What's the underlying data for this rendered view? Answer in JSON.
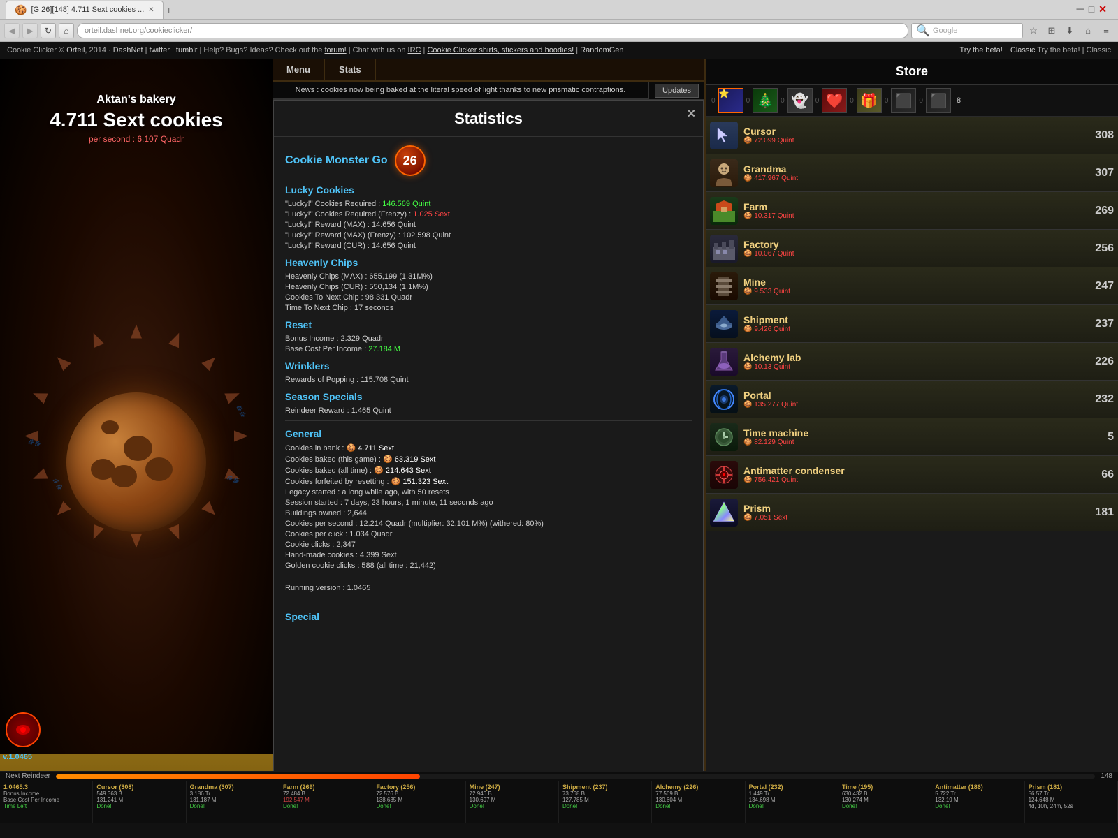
{
  "browser": {
    "tab_title": "[G 26][148] 4.711 Sext cookies ...",
    "address": "orteil.dashnet.org/cookieclicker/",
    "search_placeholder": "Google"
  },
  "site_header": {
    "copyright": "Cookie Clicker © Orteil, 2014 · DashNet | twitter | tumblr | Help? Bugs? Ideas? Check out the forum! | Chat with us on IRC | Cookie Clicker shirts, stickers and hoodies! | RandomGen",
    "twitter_link": "twitter",
    "try_beta": "Try the beta!",
    "classic": "Classic"
  },
  "bakery": {
    "name": "Aktan's bakery",
    "cookies": "4.711 Sext cookies",
    "cps": "per second : 6.107 Quadr",
    "version": "v.1.0465"
  },
  "menu": {
    "menu_label": "Menu",
    "stats_label": "Stats",
    "news": "News : cookies now being baked at the literal speed of light thanks to new prismatic contraptions.",
    "updates_label": "Updates"
  },
  "statistics": {
    "title": "Statistics",
    "close_label": "✕",
    "cm_title": "Cookie Monster Go",
    "cm_badge_num": "26",
    "lucky_section": "Lucky Cookies",
    "lucky_required_label": "\"Lucky!\" Cookies Required : ",
    "lucky_required_val": "146.569 Quint",
    "lucky_req_frenzy_label": "\"Lucky!\" Cookies Required (Frenzy) : ",
    "lucky_req_frenzy_val": "1.025 Sext",
    "lucky_max_label": "\"Lucky!\" Reward (MAX) : 14.656 Quint",
    "lucky_max_frenzy_label": "\"Lucky!\" Reward (MAX) (Frenzy) : 102.598 Quint",
    "lucky_cur_label": "\"Lucky!\" Reward (CUR) : 14.656 Quint",
    "heavenly_section": "Heavenly Chips",
    "heavenly_max_label": "Heavenly Chips (MAX) : 655,199 (1.31M%)",
    "heavenly_cur_label": "Heavenly Chips (CUR) : 550,134 (1.1M%)",
    "cookies_next_chip_label": "Cookies To Next Chip : 98.331 Quadr",
    "time_next_chip_label": "Time To Next Chip : 17 seconds",
    "reset_section": "Reset",
    "bonus_income_label": "Bonus Income : 2.329 Quadr",
    "base_cost_label": "Base Cost Per Income : ",
    "base_cost_val": "27.184 M",
    "wrinklers_section": "Wrinklers",
    "wrinklers_pop_label": "Rewards of Popping : 115.708 Quint",
    "season_section": "Season Specials",
    "reindeer_label": "Reindeer Reward : 1.465 Quint",
    "general_section": "General",
    "cookies_in_bank_label": "Cookies in bank : ",
    "cookies_in_bank_val": "4.711 Sext",
    "cookies_this_game_label": "Cookies baked (this game) : ",
    "cookies_this_game_val": "63.319 Sext",
    "cookies_all_time_label": "Cookies baked (all time) : ",
    "cookies_all_time_val": "214.643 Sext",
    "cookies_forfeited_label": "Cookies forfeited by resetting : ",
    "cookies_forfeited_val": "151.323 Sext",
    "legacy_label": "Legacy started : a long while ago, with 50 resets",
    "session_label": "Session started : 7 days, 23 hours, 1 minute, 11 seconds ago",
    "buildings_label": "Buildings owned : 2,644",
    "cps_label": "Cookies per second : 12.214 Quadr (multiplier: 32.101 M%) (withered: 80%)",
    "cpc_label": "Cookies per click : 1.034 Quadr",
    "clicks_label": "Cookie clicks : 2,347",
    "handmade_label": "Hand-made cookies : 4.399 Sext",
    "golden_label": "Golden cookie clicks : 588 (all time : 21,442)",
    "version_label": "Running version : 1.0465",
    "special_section": "Special"
  },
  "store": {
    "title": "Store",
    "special_counts": [
      "0",
      "0",
      "0",
      "0",
      "0",
      "0",
      "0",
      "8"
    ],
    "items": [
      {
        "name": "Cursor",
        "cost": "72.099 Quint",
        "count": "308",
        "icon": "👆"
      },
      {
        "name": "Grandma",
        "cost": "417.967 Quint",
        "count": "307",
        "icon": "👵"
      },
      {
        "name": "Farm",
        "cost": "10.317 Quint",
        "count": "269",
        "icon": "🌾"
      },
      {
        "name": "Factory",
        "cost": "10.067 Quint",
        "count": "256",
        "icon": "🏭"
      },
      {
        "name": "Mine",
        "cost": "9.533 Quint",
        "count": "247",
        "icon": "⛏"
      },
      {
        "name": "Shipment",
        "cost": "9.426 Quint",
        "count": "237",
        "icon": "🚀"
      },
      {
        "name": "Alchemy lab",
        "cost": "10.13 Quint",
        "count": "226",
        "icon": "⚗"
      },
      {
        "name": "Portal",
        "cost": "135.277 Quint",
        "count": "232",
        "icon": "🌀"
      },
      {
        "name": "Time machine",
        "cost": "82.129 Quint",
        "count": "5",
        "icon": "⏰"
      },
      {
        "name": "Antimatter condenser",
        "cost": "756.421 Quint",
        "count": "66",
        "icon": "⚛"
      },
      {
        "name": "Prism",
        "cost": "7.051 Sext",
        "count": "181",
        "icon": "💎"
      }
    ]
  },
  "bottom_stats": [
    {
      "label": "1.0465.3",
      "v1": "Bonus Income",
      "v2": "Base Cost Per Income",
      "v3": "Time Left",
      "val1": "",
      "val2": "",
      "val3": ""
    },
    {
      "label": "Cursor (308)",
      "v1": "549.363 B",
      "v2": "131.241 M",
      "v3": "Done!",
      "red": false
    },
    {
      "label": "Grandma (307)",
      "v1": "3.186 Tr",
      "v2": "131.187 M",
      "v3": "Done!",
      "red": false
    },
    {
      "label": "Farm (269)",
      "v1": "72.484 B",
      "v2": "192.547 M",
      "v3": "Done!",
      "red": true
    },
    {
      "label": "Factory (256)",
      "v1": "72.576 B",
      "v2": "138.635 M",
      "v3": "Done!",
      "red": false
    },
    {
      "label": "Mine (247)",
      "v1": "72.946 B",
      "v2": "130.697 M",
      "v3": "Done!",
      "red": false
    },
    {
      "label": "Shipment (237)",
      "v1": "73.768 B",
      "v2": "127.785 M",
      "v3": "Done!",
      "red": false
    },
    {
      "label": "Alchemy (226)",
      "v1": "77.569 B",
      "v2": "130.604 M",
      "v3": "Done!",
      "red": false
    },
    {
      "label": "Portal (232)",
      "v1": "1.449 Tr",
      "v2": "134.698 M",
      "v3": "Done!",
      "red": false
    },
    {
      "label": "Time (195)",
      "v1": "630.432 B",
      "v2": "130.274 M",
      "v3": "Done!",
      "red": false
    },
    {
      "label": "Antimatter (186)",
      "v1": "5.722 Tr",
      "v2": "132.19 M",
      "v3": "Done!",
      "red": false
    },
    {
      "label": "Prism (181)",
      "v1": "56.57 Tr",
      "v2": "124.648 M",
      "v3": "4d, 10h, 24m, 52s",
      "red": false
    }
  ],
  "reindeer": {
    "label": "Next Reindeer",
    "progress": 35,
    "count": "148"
  }
}
